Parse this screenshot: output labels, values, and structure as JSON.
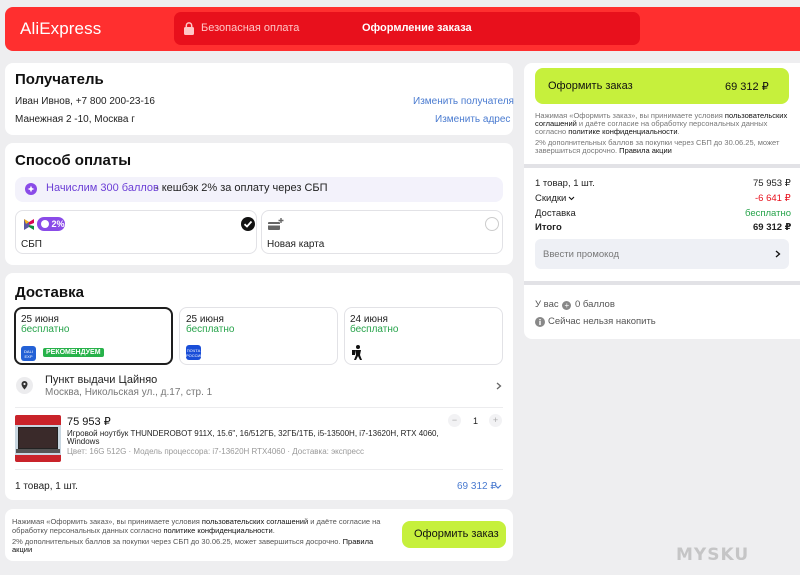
{
  "header": {
    "logo": "AliExpress",
    "secure_label": "Безопасная оплата",
    "title": "Оформление заказа"
  },
  "recipient": {
    "heading": "Получатель",
    "name_phone": "Иван Ивнов, +7 800 200-23-16",
    "address": "Манежная 2 -10, Москва г",
    "change_recipient": "Изменить получателя",
    "change_address": "Изменить адрес"
  },
  "payment": {
    "heading": "Способ оплаты",
    "bonus_highlight": "Начислим 300 баллов",
    "bonus_rest": "- кешбэк 2% за оплату через СБП",
    "sbp_badge": "2%",
    "sbp_label": "СБП",
    "new_card_label": "Новая карта"
  },
  "delivery": {
    "heading": "Доставка",
    "options": [
      {
        "date": "25 июня",
        "price": "бесплатно",
        "badge": "РЕКОМЕНДУЕМ",
        "logo_text": "DALI\nEXP"
      },
      {
        "date": "25 июня",
        "price": "бесплатно",
        "logo_text": "ПОЧТА\nРОССИИ"
      },
      {
        "date": "24 июня",
        "price": "бесплатно"
      }
    ],
    "pickup_title": "Пункт выдачи Цайняо",
    "pickup_address": "Москва, Никольская ул., д.17, стр. 1"
  },
  "product": {
    "price": "75 953 ₽",
    "name_line1": "Игровой ноутбук THUNDEROBOT 911X, 15.6\", 16/512ГБ, 32ГБ/1ТБ, i5-13500H, i7-13620H, RTX 4060,",
    "name_line2": "Windows",
    "specs": "Цвет: 16G 512G · Модель процессора: i7-13620H RTX4060 · Доставка: экспресс",
    "qty": "1",
    "minus": "−",
    "plus": "+"
  },
  "footer_summary": {
    "count": "1 товар, 1 шт.",
    "total": "69 312 ₽"
  },
  "bottom": {
    "terms_line1_a": "Нажимая «Оформить заказ», вы принимаете условия ",
    "terms_line1_b": "пользовательских соглашений",
    "terms_line1_c": " и даёте согласие на",
    "terms_line2_a": "обработку персональных данных согласно ",
    "terms_line2_b": "политике конфиденциальности",
    "terms_line2_c": ".",
    "promo_line1": "2% дополнительных баллов за покупки через СБП до 30.06.25, может завершиться досрочно. ",
    "promo_line1_b": "Правила",
    "promo_line2": "акции",
    "button": "Оформить заказ"
  },
  "side": {
    "button_label": "Оформить заказ",
    "button_total": "69 312 ₽",
    "terms_l1_a": "Нажимая «Оформить заказ», вы принимаете условия ",
    "terms_l1_b": "пользовательских",
    "terms_l2_a": "соглашений",
    "terms_l2_b": " и даёте согласие на обработку персональных данных",
    "terms_l3_a": "согласно ",
    "terms_l3_b": "политике конфиденциальности",
    "terms_l3_c": ".",
    "promo_l1": "2% дополнительных баллов за покупки через СБП до 30.06.25, может",
    "promo_l2_a": "завершиться досрочно. ",
    "promo_l2_b": "Правила акции",
    "items_label": "1 товар, 1 шт.",
    "items_value": "75 953 ₽",
    "discount_label": "Скидки",
    "discount_value": "-6 641 ₽",
    "delivery_label": "Доставка",
    "delivery_value": "бесплатно",
    "total_label": "Итого",
    "total_value": "69 312 ₽",
    "promo_code": "Ввести промокод",
    "points_a": "У вас",
    "points_b": "0 баллов",
    "cannot_accumulate": "Сейчас нельзя накопить"
  },
  "watermark": "MYSKU",
  "colors": {
    "brand_red": "#ff2f2f",
    "accent_green": "#c6f03c",
    "link": "#4a7bd0",
    "free_green": "#26a34a"
  }
}
